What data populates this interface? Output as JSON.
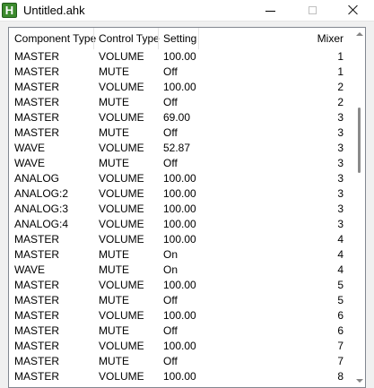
{
  "window": {
    "title": "Untitled.ahk",
    "icon_letter": "H"
  },
  "listview": {
    "columns": [
      "Component Type",
      "Control Type",
      "Setting",
      "Mixer"
    ],
    "rows": [
      [
        "MASTER",
        "VOLUME",
        "100.00",
        "1"
      ],
      [
        "MASTER",
        "MUTE",
        "Off",
        "1"
      ],
      [
        "MASTER",
        "VOLUME",
        "100.00",
        "2"
      ],
      [
        "MASTER",
        "MUTE",
        "Off",
        "2"
      ],
      [
        "MASTER",
        "VOLUME",
        "69.00",
        "3"
      ],
      [
        "MASTER",
        "MUTE",
        "Off",
        "3"
      ],
      [
        "WAVE",
        "VOLUME",
        "52.87",
        "3"
      ],
      [
        "WAVE",
        "MUTE",
        "Off",
        "3"
      ],
      [
        "ANALOG",
        "VOLUME",
        "100.00",
        "3"
      ],
      [
        "ANALOG:2",
        "VOLUME",
        "100.00",
        "3"
      ],
      [
        "ANALOG:3",
        "VOLUME",
        "100.00",
        "3"
      ],
      [
        "ANALOG:4",
        "VOLUME",
        "100.00",
        "3"
      ],
      [
        "MASTER",
        "VOLUME",
        "100.00",
        "4"
      ],
      [
        "MASTER",
        "MUTE",
        "On",
        "4"
      ],
      [
        "WAVE",
        "MUTE",
        "On",
        "4"
      ],
      [
        "MASTER",
        "VOLUME",
        "100.00",
        "5"
      ],
      [
        "MASTER",
        "MUTE",
        "Off",
        "5"
      ],
      [
        "MASTER",
        "VOLUME",
        "100.00",
        "6"
      ],
      [
        "MASTER",
        "MUTE",
        "Off",
        "6"
      ],
      [
        "MASTER",
        "VOLUME",
        "100.00",
        "7"
      ],
      [
        "MASTER",
        "MUTE",
        "Off",
        "7"
      ],
      [
        "MASTER",
        "VOLUME",
        "100.00",
        "8"
      ]
    ]
  }
}
